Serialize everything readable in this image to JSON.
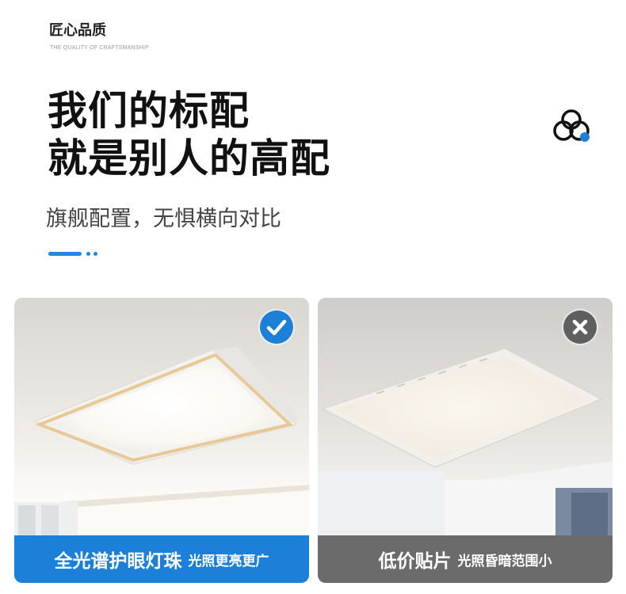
{
  "brand": {
    "title": "匠心品质",
    "subtitle": "THE QUALITY OF CRAFTSMANSHIP"
  },
  "headline": {
    "line1": "我们的标配",
    "line2": "就是别人的高配"
  },
  "subheadline": "旗舰配置，无惧横向对比",
  "logo_icon": "three-circles-icon",
  "colors": {
    "accent": "#1c7fd8",
    "gray": "#6b6b6b"
  },
  "comparison": {
    "good": {
      "icon": "checkmark-icon",
      "title": "全光谱护眼灯珠",
      "note": "光照更亮更广"
    },
    "bad": {
      "icon": "cross-icon",
      "title": "低价贴片",
      "note": "光照昏暗范围小"
    }
  }
}
